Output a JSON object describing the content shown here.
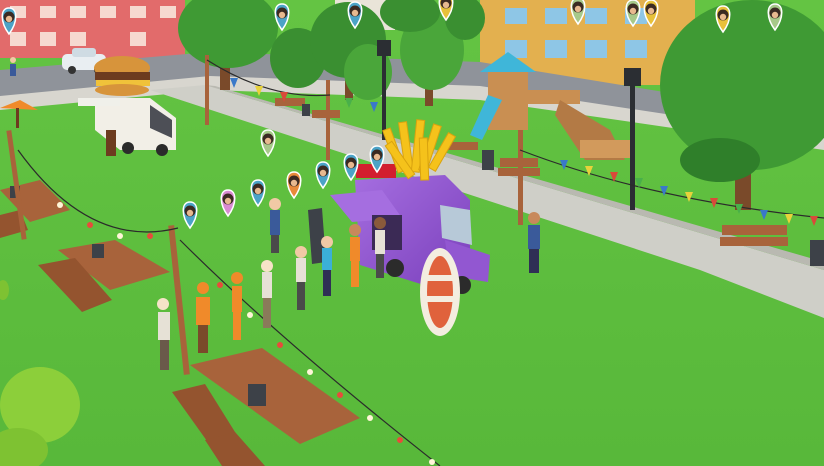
{
  "scene": {
    "colors": {
      "grass": "#5fbf3f",
      "grass_dark": "#4ea833",
      "path": "#c9c9c2",
      "street": "#8f939a",
      "truck_purple": "#8a4fc9",
      "burger_truck": "#f2efe7",
      "fries": "#f5c21b",
      "tree": "#3f9a34",
      "tree_light": "#8ccf3a",
      "bench_wood": "#a8633b",
      "slide_blue": "#3fb6d9",
      "building_yellow": "#e3b04f",
      "building_red": "#e26b6b",
      "bunting_colors": [
        "#d94a3a",
        "#3a79c9",
        "#e8d23b",
        "#49b04a",
        "#8a4fc9"
      ]
    },
    "customer_pins": [
      {
        "id": "pin-1",
        "ring": "#4ba3c7"
      },
      {
        "id": "pin-2",
        "ring": "#4ba3c7"
      },
      {
        "id": "pin-3",
        "ring": "#4ba3c7"
      },
      {
        "id": "pin-4",
        "ring": "#e8c13a"
      },
      {
        "id": "pin-5",
        "ring": "#a7c98a"
      },
      {
        "id": "pin-6",
        "ring": "#a7c98a"
      },
      {
        "id": "pin-7",
        "ring": "#e8c13a"
      },
      {
        "id": "pin-8",
        "ring": "#e8c13a"
      },
      {
        "id": "pin-9",
        "ring": "#a7c98a"
      },
      {
        "id": "pin-10",
        "ring": "#a7c98a"
      },
      {
        "id": "pin-11",
        "ring": "#4ba3c7"
      },
      {
        "id": "pin-12",
        "ring": "#4ba3c7"
      },
      {
        "id": "pin-13",
        "ring": "#4ba3c7"
      },
      {
        "id": "pin-14",
        "ring": "#e88a3a"
      },
      {
        "id": "pin-15",
        "ring": "#4ba3c7"
      },
      {
        "id": "pin-16",
        "ring": "#d98bd1"
      },
      {
        "id": "pin-17",
        "ring": "#4ba3c7"
      }
    ],
    "icons": {
      "customer_pin": "customer-pin-icon",
      "lamp": "street-lamp-icon"
    }
  }
}
